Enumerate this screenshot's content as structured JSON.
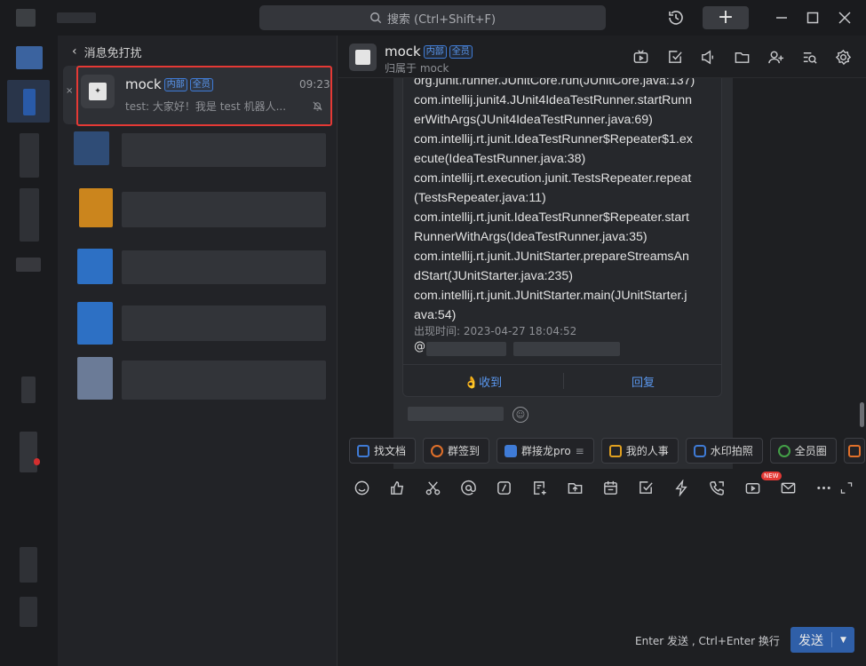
{
  "topbar": {
    "search_placeholder": "搜索 (Ctrl+Shift+F)",
    "add_label": "+"
  },
  "conversation_list": {
    "header": "消息免打扰",
    "selected": {
      "name": "mock",
      "badges": [
        "内部",
        "全员"
      ],
      "time": "09:23",
      "preview": "test: 大家好！我是 test 机器人..."
    }
  },
  "chat": {
    "title": "mock",
    "badges": [
      "内部",
      "全员"
    ],
    "subtitle": "归属于 mock",
    "message": {
      "lines": [
        "org.junit.runner.JUnitCore.run(JUnitCore.java:137)",
        "com.intellij.junit4.JUnit4IdeaTestRunner.startRunn",
        "erWithArgs(JUnit4IdeaTestRunner.java:69)",
        "com.intellij.rt.junit.IdeaTestRunner$Repeater$1.ex",
        "ecute(IdeaTestRunner.java:38)",
        "com.intellij.rt.execution.junit.TestsRepeater.repeat",
        "(TestsRepeater.java:11)",
        "com.intellij.rt.junit.IdeaTestRunner$Repeater.start",
        "RunnerWithArgs(IdeaTestRunner.java:35)",
        "com.intellij.rt.junit.JUnitStarter.prepareStreamsAn",
        "dStart(JUnitStarter.java:235)",
        "com.intellij.rt.junit.JUnitStarter.main(JUnitStarter.j",
        "ava:54)"
      ],
      "timestamp": "出现时间: 2023-04-27 18:04:52",
      "mention_prefix": "@",
      "actions": {
        "received": "👌收到",
        "reply": "回复"
      }
    },
    "tools": [
      "找文档",
      "群签到",
      "群接龙pro",
      "我的人事",
      "水印拍照",
      "全员圈"
    ],
    "tool_icon_colors": [
      "#3f7bd6",
      "#e0702a",
      "#3f7bd6",
      "#e0a020",
      "#3f7bd6",
      "#43a047"
    ],
    "new_tag": "NEW",
    "input_hint": "Enter 发送 , Ctrl+Enter 换行",
    "send_label": "发送"
  }
}
